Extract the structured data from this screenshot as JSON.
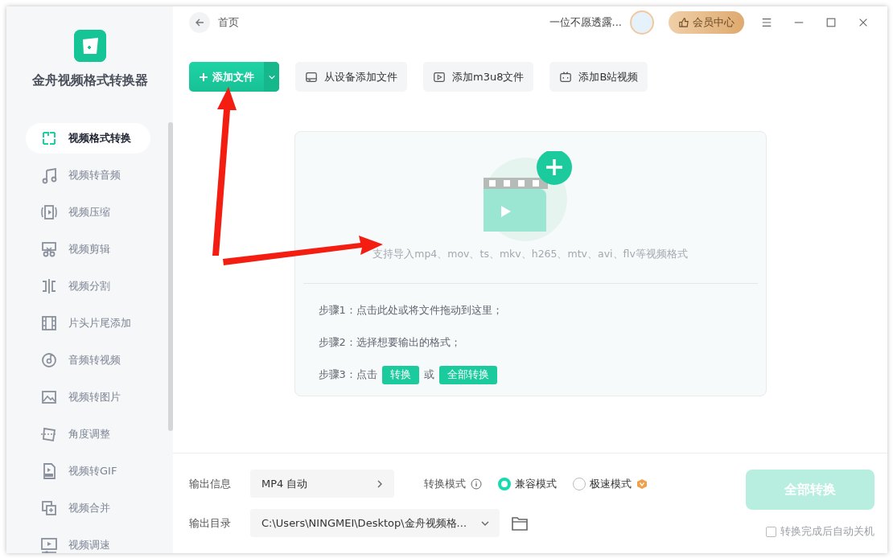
{
  "app": {
    "name": "金舟视频格式转换器"
  },
  "nav": [
    {
      "label": "视频格式转换",
      "selected": true
    },
    {
      "label": "视频转音频",
      "selected": false
    },
    {
      "label": "视频压缩",
      "selected": false
    },
    {
      "label": "视频剪辑",
      "selected": false
    },
    {
      "label": "视频分割",
      "selected": false
    },
    {
      "label": "片头片尾添加",
      "selected": false
    },
    {
      "label": "音频转视频",
      "selected": false
    },
    {
      "label": "视频转图片",
      "selected": false
    },
    {
      "label": "角度调整",
      "selected": false
    },
    {
      "label": "视频转GIF",
      "selected": false
    },
    {
      "label": "视频合并",
      "selected": false
    },
    {
      "label": "视频调速",
      "selected": false
    }
  ],
  "header": {
    "page_title": "首页",
    "user_name": "一位不愿透露...",
    "vip_label": "会员中心"
  },
  "toolbar": {
    "add_file": "添加文件",
    "buttons": [
      {
        "label": "从设备添加文件"
      },
      {
        "label": "添加m3u8文件"
      },
      {
        "label": "添加B站视频"
      }
    ]
  },
  "dropzone": {
    "hint": "支持导入mp4、mov、ts、mkv、h265、mtv、avi、flv等视频格式",
    "steps": [
      {
        "label": "步骤1：",
        "text": "点击此处或将文件拖动到这里；"
      },
      {
        "label": "步骤2：",
        "text": "选择想要输出的格式；"
      },
      {
        "label": "步骤3：",
        "text": "点击",
        "buttons": [
          "转换",
          "全部转换"
        ],
        "joiner": "或"
      }
    ]
  },
  "output": {
    "info_label": "输出信息",
    "info_value": "MP4 自动",
    "mode_label": "转换模式",
    "modes": [
      {
        "label": "兼容模式",
        "selected": true,
        "premium": false
      },
      {
        "label": "极速模式",
        "selected": false,
        "premium": true
      }
    ],
    "dir_label": "输出目录",
    "dir_value": "C:\\Users\\NINGMEI\\Desktop\\金舟视频格...",
    "convert_label": "全部转换",
    "convert_disabled": true,
    "auto_shutdown": {
      "label": "转换完成后自动关机",
      "checked": false
    }
  }
}
